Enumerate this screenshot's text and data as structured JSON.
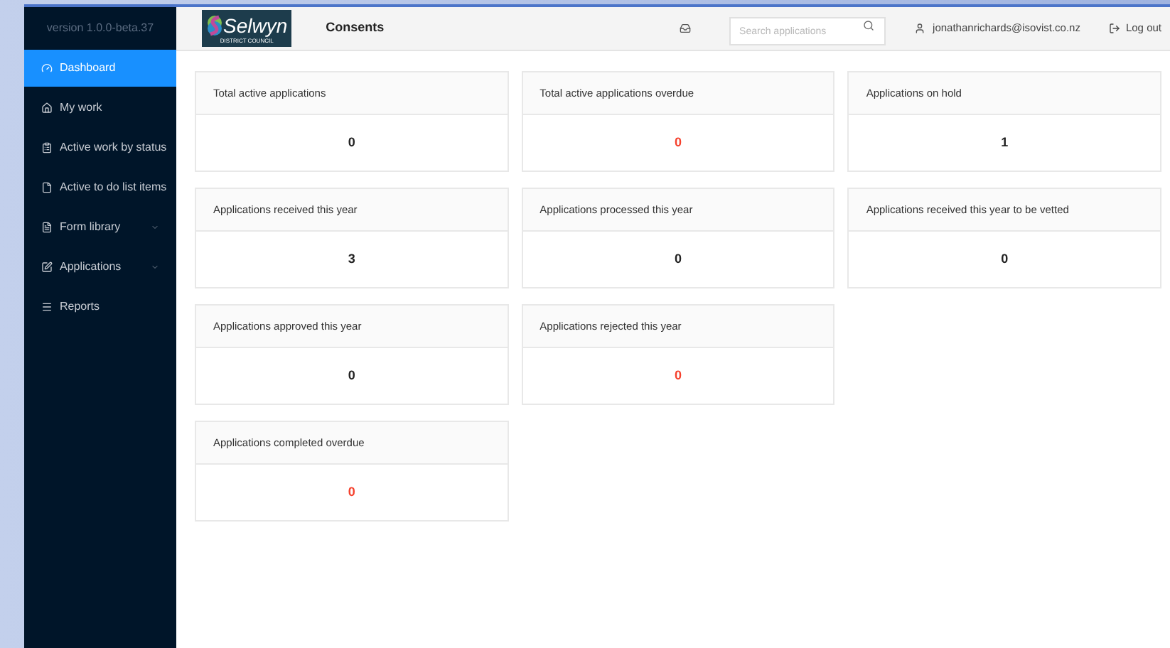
{
  "sidebar": {
    "version": "version 1.0.0-beta.37",
    "items": [
      {
        "label": "Dashboard",
        "selected": true,
        "expandable": false
      },
      {
        "label": "My work",
        "selected": false,
        "expandable": false
      },
      {
        "label": "Active work by status",
        "selected": false,
        "expandable": false
      },
      {
        "label": "Active to do list items",
        "selected": false,
        "expandable": false
      },
      {
        "label": "Form library",
        "selected": false,
        "expandable": true
      },
      {
        "label": "Applications",
        "selected": false,
        "expandable": true
      },
      {
        "label": "Reports",
        "selected": false,
        "expandable": false
      }
    ]
  },
  "header": {
    "logo": {
      "name": "Selwyn",
      "tagline": "DISTRICT COUNCIL"
    },
    "title": "Consents",
    "search": {
      "placeholder": "Search applications"
    },
    "user": "jonathanrichards@isovist.co.nz",
    "logout": "Log out"
  },
  "card_rows": [
    [
      {
        "title": "Total active applications",
        "value": "0",
        "alert": false
      },
      {
        "title": "Total active applications overdue",
        "value": "0",
        "alert": true
      },
      {
        "title": "Applications on hold",
        "value": "1",
        "alert": false
      }
    ],
    [
      {
        "title": "Applications received this year",
        "value": "3",
        "alert": false
      },
      {
        "title": "Applications processed this year",
        "value": "0",
        "alert": false
      },
      {
        "title": "Applications received this year to be vetted",
        "value": "0",
        "alert": false
      }
    ],
    [
      {
        "title": "Applications approved this year",
        "value": "0",
        "alert": false
      },
      {
        "title": "Applications rejected this year",
        "value": "0",
        "alert": true
      }
    ],
    [
      {
        "title": "Applications completed overdue",
        "value": "0",
        "alert": true
      }
    ]
  ]
}
